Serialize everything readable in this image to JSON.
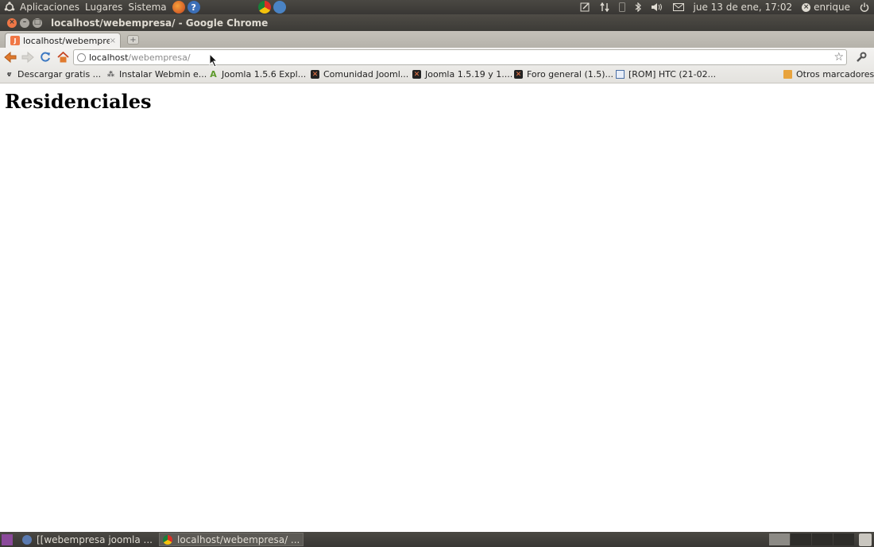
{
  "top_panel": {
    "menus": [
      "Aplicaciones",
      "Lugares",
      "Sistema"
    ],
    "datetime": "jue 13 de ene, 17:02",
    "user": "enrique"
  },
  "window": {
    "title": "localhost/webempresa/ - Google Chrome"
  },
  "tabs": [
    {
      "title": "localhost/webempresa/",
      "close": "×"
    }
  ],
  "toolbar": {
    "new_tab": "+",
    "url_host": "localhost",
    "url_path": "/webempresa/",
    "star": "☆"
  },
  "bookmarks": {
    "items": [
      {
        "label": "Descargar gratis ...",
        "icon": "v-icon"
      },
      {
        "label": "Instalar Webmin e...",
        "icon": "webmin-icon"
      },
      {
        "label": "Joomla 1.5.6 Expl...",
        "icon": "a-icon"
      },
      {
        "label": "Comunidad Jooml...",
        "icon": "joomla-icon"
      },
      {
        "label": "Joomla 1.5.19 y 1....",
        "icon": "joomla-icon"
      },
      {
        "label": "Foro general (1.5)...",
        "icon": "joomla-icon"
      },
      {
        "label": "[ROM] HTC (21-02...",
        "icon": "doc-icon"
      }
    ],
    "other": "Otros marcadores"
  },
  "content": {
    "heading": "Residenciales"
  },
  "taskbar": {
    "tasks": [
      {
        "label": "[[webempresa joomla ..."
      },
      {
        "label": "localhost/webempresa/ ..."
      }
    ]
  }
}
